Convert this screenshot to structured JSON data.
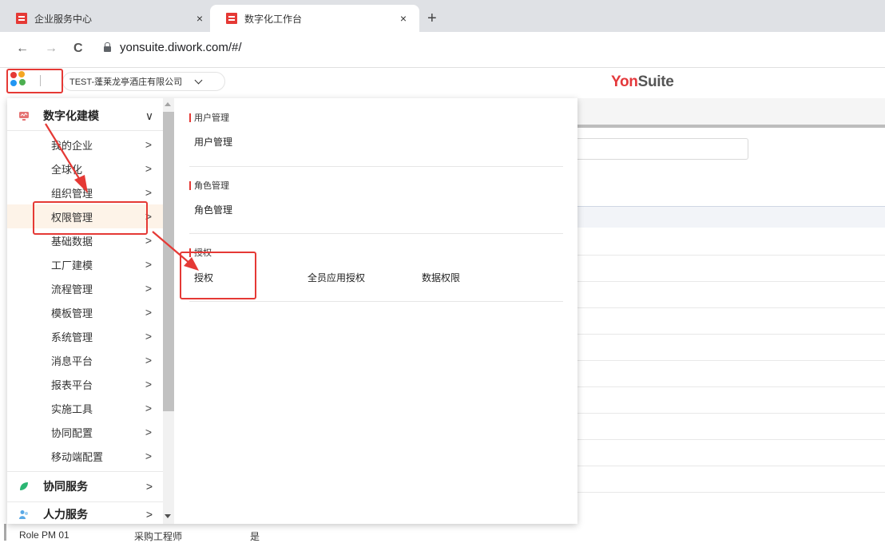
{
  "browser": {
    "tabs": [
      {
        "label": "企业服务中心",
        "close": "×"
      },
      {
        "label": "数字化工作台",
        "close": "×"
      }
    ],
    "new_tab": "+",
    "back": "←",
    "forward": "→",
    "reload": "C",
    "url": "yonsuite.diwork.com/#/"
  },
  "header": {
    "org": "TEST-蓬莱龙亭酒庄有限公司",
    "logo_yon": "Yon",
    "logo_suite": "Suite"
  },
  "menu": {
    "categories": [
      {
        "label": "数字化建模",
        "arrow": "∨",
        "icon": "modeling-icon",
        "color": "#e57373"
      },
      {
        "label": "协同服务",
        "arrow": ">",
        "icon": "leaf-icon",
        "color": "#2bb673"
      },
      {
        "label": "人力服务",
        "arrow": "> ",
        "icon": "people-icon",
        "color": "#5aa9e6"
      }
    ],
    "items": [
      {
        "label": "我的企业",
        "arrow": ">"
      },
      {
        "label": "全球化",
        "arrow": ">"
      },
      {
        "label": "组织管理",
        "arrow": ">"
      },
      {
        "label": "权限管理",
        "arrow": ">"
      },
      {
        "label": "基础数据",
        "arrow": ">"
      },
      {
        "label": "工厂建模",
        "arrow": ">"
      },
      {
        "label": "流程管理",
        "arrow": ">"
      },
      {
        "label": "模板管理",
        "arrow": ">"
      },
      {
        "label": "系统管理",
        "arrow": ">"
      },
      {
        "label": "消息平台",
        "arrow": ">"
      },
      {
        "label": "报表平台",
        "arrow": ">"
      },
      {
        "label": "实施工具",
        "arrow": ">"
      },
      {
        "label": "协同配置",
        "arrow": ">"
      },
      {
        "label": "移动端配置",
        "arrow": ">"
      }
    ],
    "selected_index": 3
  },
  "panel": {
    "sections": [
      {
        "title": "用户管理",
        "links": [
          "用户管理"
        ]
      },
      {
        "title": "角色管理",
        "links": [
          "角色管理"
        ]
      },
      {
        "title": "授权",
        "links": [
          "授权",
          "全员应用授权",
          "数据权限"
        ]
      }
    ]
  },
  "background": {
    "row_cells": [
      "Role PM 01",
      "采购工程师",
      "是"
    ]
  },
  "colors": {
    "accent": "#e53935",
    "selected_bg": "#fdf3e8"
  }
}
